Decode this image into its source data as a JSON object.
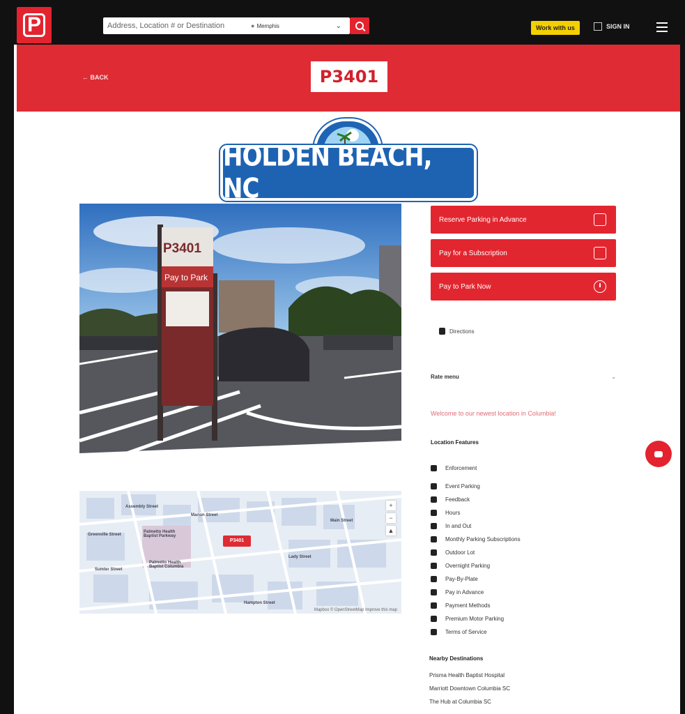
{
  "header": {
    "logo": "P",
    "search_placeholder": "Address, Location # or Destination",
    "location_value": "Memphis",
    "work_with_us": "Work with us",
    "sign_in": "SIGN IN"
  },
  "banner": {
    "back": "← BACK",
    "lot_number": "P3401"
  },
  "location_sign": {
    "text": "HOLDEN BEACH, NC"
  },
  "photo": {
    "sign_number": "P3401",
    "sign_pay": "Pay to Park"
  },
  "map": {
    "lot_badge": "P3401",
    "labels": [
      "Greenville Street",
      "Palmetto Health Baptist Parkway",
      "Palmetto Health Baptist Columbia",
      "Lady Street",
      "Marion Street",
      "Main Street",
      "Hampton Street",
      "Sumter Street",
      "Assembly Street"
    ],
    "zoom_in": "+",
    "zoom_out": "−",
    "attribution": "Mapbox © OpenStreetMap Improve this map"
  },
  "actions": {
    "reserve": "Reserve Parking in Advance",
    "subscription": "Pay for a Subscription",
    "pay_now": "Pay to Park Now"
  },
  "directions": "Directions",
  "rate_menu": "Rate menu",
  "welcome": "Welcome to our newest location in Columbia!",
  "features_title": "Location Features",
  "features": [
    "Enforcement",
    "Event Parking",
    "Feedback",
    "Hours",
    "In and Out",
    "Monthly Parking Subscriptions",
    "Outdoor Lot",
    "Overnight Parking",
    "Pay-By-Plate",
    "Pay in Advance",
    "Payment Methods",
    "Premium Motor Parking",
    "Terms of Service"
  ],
  "nearby_title": "Nearby Destinations",
  "nearby": [
    "Prisma Health Baptist Hospital",
    "Marriott Downtown Columbia SC",
    "The Hub at Columbia SC"
  ],
  "colors": {
    "brand_red": "#e3232e",
    "banner_red": "#df2b34",
    "work_yellow": "#f5d000",
    "nav_black": "#111111",
    "sign_blue": "#1e63b2"
  }
}
